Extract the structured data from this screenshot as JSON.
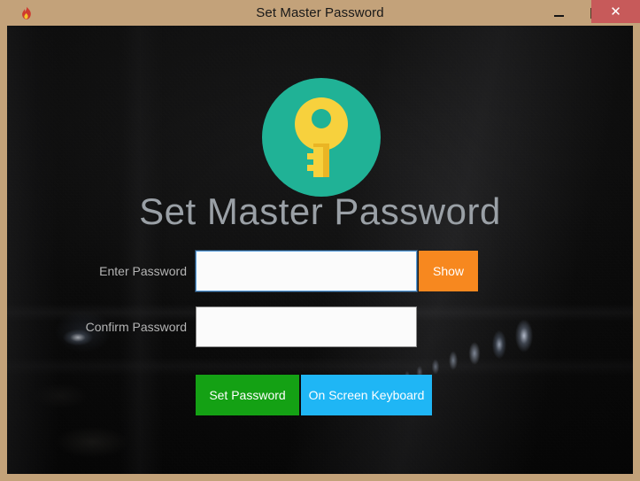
{
  "window": {
    "title": "Set Master Password",
    "app_icon": "flame-icon",
    "controls": {
      "minimize_label": "–",
      "maximize_label": "□",
      "close_label": "✕"
    },
    "colors": {
      "titlebar_bg": "#c3a27a",
      "close_bg": "#c75a5a",
      "frame_border": "#c3a279"
    }
  },
  "main": {
    "logo": {
      "icon": "key-icon",
      "circle_color": "#20b296",
      "key_color": "#f7d13d"
    },
    "heading": "Set Master Password",
    "fields": [
      {
        "label": "Enter Password",
        "value": "",
        "placeholder": "",
        "focused": true,
        "name": "enter-password-input"
      },
      {
        "label": "Confirm Password",
        "value": "",
        "placeholder": "",
        "focused": false,
        "name": "confirm-password-input"
      }
    ],
    "show_button": {
      "label": "Show",
      "color": "#f7881f"
    },
    "actions": [
      {
        "label": "Set Password",
        "color": "#14a114",
        "name": "set-password-button"
      },
      {
        "label": "On Screen Keyboard",
        "color": "#1fb6f5",
        "name": "on-screen-keyboard-button"
      }
    ]
  }
}
